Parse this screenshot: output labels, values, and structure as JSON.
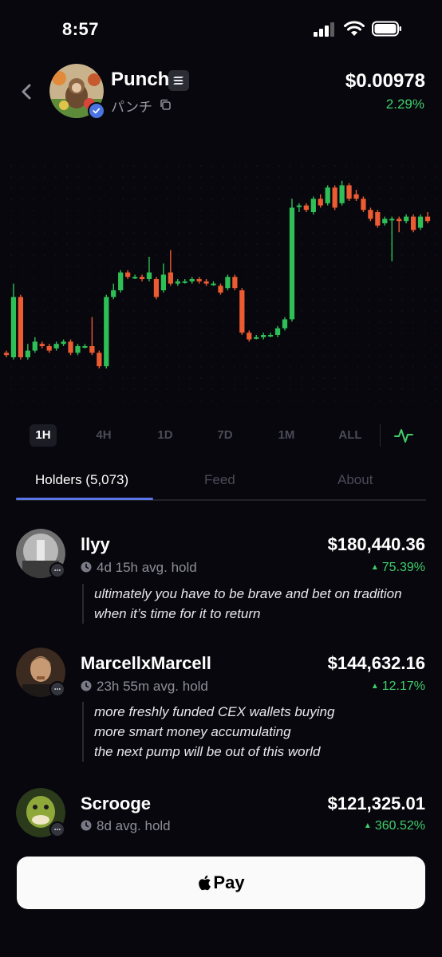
{
  "status_bar": {
    "time": "8:57"
  },
  "token": {
    "name": "Punch",
    "subtitle": "パンチ",
    "price": "$0.00978",
    "change": "2.29%",
    "change_color": "#3fcf6b"
  },
  "chart_data": {
    "type": "candlestick",
    "up_color": "#2fbf57",
    "down_color": "#ec5b31",
    "note_units": "price relative scale (0 = chart bottom, 100 = chart top)",
    "candles": [
      {
        "o": 17,
        "c": 16,
        "h": 18,
        "l": 15
      },
      {
        "o": 15,
        "c": 42,
        "h": 48,
        "l": 14
      },
      {
        "o": 42,
        "c": 15,
        "h": 43,
        "l": 14
      },
      {
        "o": 15,
        "c": 18,
        "h": 21,
        "l": 14
      },
      {
        "o": 18,
        "c": 22,
        "h": 24,
        "l": 17
      },
      {
        "o": 21,
        "c": 20,
        "h": 22,
        "l": 19
      },
      {
        "o": 20,
        "c": 18,
        "h": 21,
        "l": 17
      },
      {
        "o": 19,
        "c": 21,
        "h": 22,
        "l": 18
      },
      {
        "o": 21,
        "c": 22,
        "h": 23,
        "l": 20
      },
      {
        "o": 22,
        "c": 17,
        "h": 23,
        "l": 16
      },
      {
        "o": 17,
        "c": 20,
        "h": 21,
        "l": 16
      },
      {
        "o": 20,
        "c": 20,
        "h": 21,
        "l": 19
      },
      {
        "o": 20,
        "c": 17,
        "h": 33,
        "l": 16
      },
      {
        "o": 17,
        "c": 11,
        "h": 18,
        "l": 10
      },
      {
        "o": 11,
        "c": 42,
        "h": 43,
        "l": 10
      },
      {
        "o": 42,
        "c": 45,
        "h": 48,
        "l": 41
      },
      {
        "o": 45,
        "c": 53,
        "h": 54,
        "l": 44
      },
      {
        "o": 53,
        "c": 51,
        "h": 54,
        "l": 50
      },
      {
        "o": 51,
        "c": 51,
        "h": 52,
        "l": 50
      },
      {
        "o": 51,
        "c": 50,
        "h": 52,
        "l": 49
      },
      {
        "o": 50,
        "c": 53,
        "h": 60,
        "l": 49
      },
      {
        "o": 50,
        "c": 42,
        "h": 51,
        "l": 41
      },
      {
        "o": 45,
        "c": 52,
        "h": 57,
        "l": 44
      },
      {
        "o": 53,
        "c": 48,
        "h": 63,
        "l": 47
      },
      {
        "o": 48,
        "c": 49,
        "h": 50,
        "l": 47
      },
      {
        "o": 49,
        "c": 49,
        "h": 50,
        "l": 48
      },
      {
        "o": 49,
        "c": 50,
        "h": 51,
        "l": 48
      },
      {
        "o": 50,
        "c": 49,
        "h": 51,
        "l": 48
      },
      {
        "o": 49,
        "c": 48,
        "h": 50,
        "l": 47
      },
      {
        "o": 48,
        "c": 48,
        "h": 49,
        "l": 47
      },
      {
        "o": 47,
        "c": 44,
        "h": 48,
        "l": 43
      },
      {
        "o": 46,
        "c": 51,
        "h": 52,
        "l": 45
      },
      {
        "o": 51,
        "c": 46,
        "h": 52,
        "l": 45
      },
      {
        "o": 45,
        "c": 26,
        "h": 46,
        "l": 25
      },
      {
        "o": 26,
        "c": 23,
        "h": 27,
        "l": 22
      },
      {
        "o": 24,
        "c": 24,
        "h": 25,
        "l": 23
      },
      {
        "o": 24,
        "c": 25,
        "h": 26,
        "l": 23
      },
      {
        "o": 25,
        "c": 25,
        "h": 26,
        "l": 24
      },
      {
        "o": 25,
        "c": 28,
        "h": 29,
        "l": 24
      },
      {
        "o": 28,
        "c": 32,
        "h": 33,
        "l": 27
      },
      {
        "o": 32,
        "c": 82,
        "h": 86,
        "l": 31
      },
      {
        "o": 83,
        "c": 83,
        "h": 84,
        "l": 80
      },
      {
        "o": 83,
        "c": 81,
        "h": 84,
        "l": 80
      },
      {
        "o": 80,
        "c": 86,
        "h": 87,
        "l": 79
      },
      {
        "o": 86,
        "c": 83,
        "h": 88,
        "l": 82
      },
      {
        "o": 84,
        "c": 91,
        "h": 92,
        "l": 83
      },
      {
        "o": 91,
        "c": 82,
        "h": 92,
        "l": 81
      },
      {
        "o": 84,
        "c": 92,
        "h": 94,
        "l": 83
      },
      {
        "o": 92,
        "c": 86,
        "h": 93,
        "l": 85
      },
      {
        "o": 88,
        "c": 86,
        "h": 90,
        "l": 85
      },
      {
        "o": 86,
        "c": 81,
        "h": 87,
        "l": 80
      },
      {
        "o": 81,
        "c": 77,
        "h": 82,
        "l": 76
      },
      {
        "o": 80,
        "c": 74,
        "h": 81,
        "l": 73
      },
      {
        "o": 75,
        "c": 77,
        "h": 78,
        "l": 74
      },
      {
        "o": 77,
        "c": 77,
        "h": 78,
        "l": 58
      },
      {
        "o": 77,
        "c": 76,
        "h": 78,
        "l": 71
      },
      {
        "o": 76,
        "c": 78,
        "h": 79,
        "l": 75
      },
      {
        "o": 78,
        "c": 72,
        "h": 79,
        "l": 71
      },
      {
        "o": 73,
        "c": 78,
        "h": 79,
        "l": 72
      },
      {
        "o": 78,
        "c": 76,
        "h": 80,
        "l": 75
      }
    ]
  },
  "timeframes": {
    "items": [
      "1H",
      "4H",
      "1D",
      "7D",
      "1M",
      "ALL"
    ],
    "active": "1H"
  },
  "tabs": {
    "items": [
      "Holders (5,073)",
      "Feed",
      "About"
    ],
    "active": "Holders (5,073)"
  },
  "holders": [
    {
      "name": "llyy",
      "hold": "4d 15h avg. hold",
      "value": "$180,440.36",
      "pct": "75.39%",
      "message": [
        "ultimately you have to be brave and bet on tradition",
        "when it’s time for it to return"
      ]
    },
    {
      "name": "MarcellxMarcell",
      "hold": "23h 55m avg. hold",
      "value": "$144,632.16",
      "pct": "12.17%",
      "message": [
        "more freshly funded CEX wallets buying",
        "more smart money accumulating",
        "the next pump will be out of this world"
      ]
    },
    {
      "name": "Scrooge",
      "hold": "8d avg. hold",
      "value": "$121,325.01",
      "pct": "360.52%",
      "message": []
    }
  ],
  "pay_button": {
    "label": "Pay"
  },
  "icons": {
    "back": "chevron-left-icon",
    "copy": "copy-icon",
    "verified": "verified-check-icon",
    "chain": "solana-icon",
    "chart_toggle": "pulse-line-icon",
    "hold": "clock-icon",
    "chat": "chat-bubble-icon",
    "pay": "apple-logo-icon"
  }
}
